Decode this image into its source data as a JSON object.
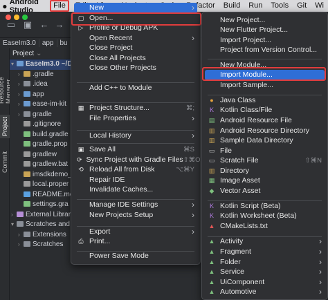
{
  "menubar": {
    "apple": "",
    "app_name": "Android Studio",
    "items": [
      "File",
      "Edit",
      "View",
      "Navigate",
      "Code",
      "Refactor",
      "Build",
      "Run",
      "Tools",
      "Git",
      "Wi"
    ]
  },
  "breadcrumb": [
    "EaseIm3.0",
    "app",
    "bu"
  ],
  "side_labels": [
    "Resource Manager",
    "Project",
    "Commit"
  ],
  "project_panel": {
    "title": "Project",
    "rows": [
      "EaseIm3.0 ~/D",
      ".gradle",
      ".idea",
      "app",
      "ease-im-kit",
      "gradle",
      ".gitignore",
      "build.gradle",
      "gradle.prop",
      "gradlew",
      "gradlew.bat",
      "imsdkdemo_",
      "local.proper",
      "README.mc",
      "settings.gra",
      "External Librari",
      "Scratches and",
      "Extensions",
      "Scratches"
    ]
  },
  "file_menu": {
    "items": [
      {
        "label": "New",
        "shortcut": "",
        "submenu": true
      },
      {
        "label": "Open...",
        "shortcut": ""
      },
      {
        "label": "Profile or Debug APK",
        "shortcut": ""
      },
      {
        "label": "Open Recent",
        "shortcut": "",
        "submenu": true
      },
      {
        "label": "Close Project",
        "shortcut": ""
      },
      {
        "label": "Close All Projects",
        "shortcut": ""
      },
      {
        "label": "Close Other Projects",
        "shortcut": ""
      },
      {
        "label": "Add C++ to Module",
        "shortcut": ""
      },
      {
        "label": "Project Structure...",
        "shortcut": "⌘;"
      },
      {
        "label": "File Properties",
        "shortcut": "",
        "submenu": true
      },
      {
        "label": "Local History",
        "shortcut": "",
        "submenu": true
      },
      {
        "label": "Save All",
        "shortcut": "⌘S"
      },
      {
        "label": "Sync Project with Gradle Files",
        "shortcut": "⇧⌘O"
      },
      {
        "label": "Reload All from Disk",
        "shortcut": "⌥⌘Y"
      },
      {
        "label": "Repair IDE",
        "shortcut": ""
      },
      {
        "label": "Invalidate Caches...",
        "shortcut": ""
      },
      {
        "label": "Manage IDE Settings",
        "shortcut": "",
        "submenu": true
      },
      {
        "label": "New Projects Setup",
        "shortcut": "",
        "submenu": true
      },
      {
        "label": "Export",
        "shortcut": "",
        "submenu": true
      },
      {
        "label": "Print...",
        "shortcut": ""
      },
      {
        "label": "Power Save Mode",
        "shortcut": ""
      }
    ]
  },
  "new_menu": {
    "items": [
      {
        "label": "New Project..."
      },
      {
        "label": "New Flutter Project..."
      },
      {
        "label": "Import Project..."
      },
      {
        "label": "Project from Version Control..."
      },
      {
        "label": "New Module..."
      },
      {
        "label": "Import Module..."
      },
      {
        "label": "Import Sample..."
      },
      {
        "label": "Java Class"
      },
      {
        "label": "Kotlin Class/File"
      },
      {
        "label": "Android Resource File"
      },
      {
        "label": "Android Resource Directory"
      },
      {
        "label": "Sample Data Directory"
      },
      {
        "label": "File"
      },
      {
        "label": "Scratch File",
        "shortcut": "⇧⌘N"
      },
      {
        "label": "Directory"
      },
      {
        "label": "Image Asset"
      },
      {
        "label": "Vector Asset"
      },
      {
        "label": "Kotlin Script (Beta)"
      },
      {
        "label": "Kotlin Worksheet (Beta)"
      },
      {
        "label": "CMakeLists.txt"
      },
      {
        "label": "Activity",
        "submenu": true
      },
      {
        "label": "Fragment",
        "submenu": true
      },
      {
        "label": "Folder",
        "submenu": true
      },
      {
        "label": "Service",
        "submenu": true
      },
      {
        "label": "UiComponent",
        "submenu": true
      },
      {
        "label": "Automotive",
        "submenu": true
      }
    ]
  },
  "colors": {
    "highlight": "#2f6ed6",
    "red_outline": "#e23c3c"
  }
}
